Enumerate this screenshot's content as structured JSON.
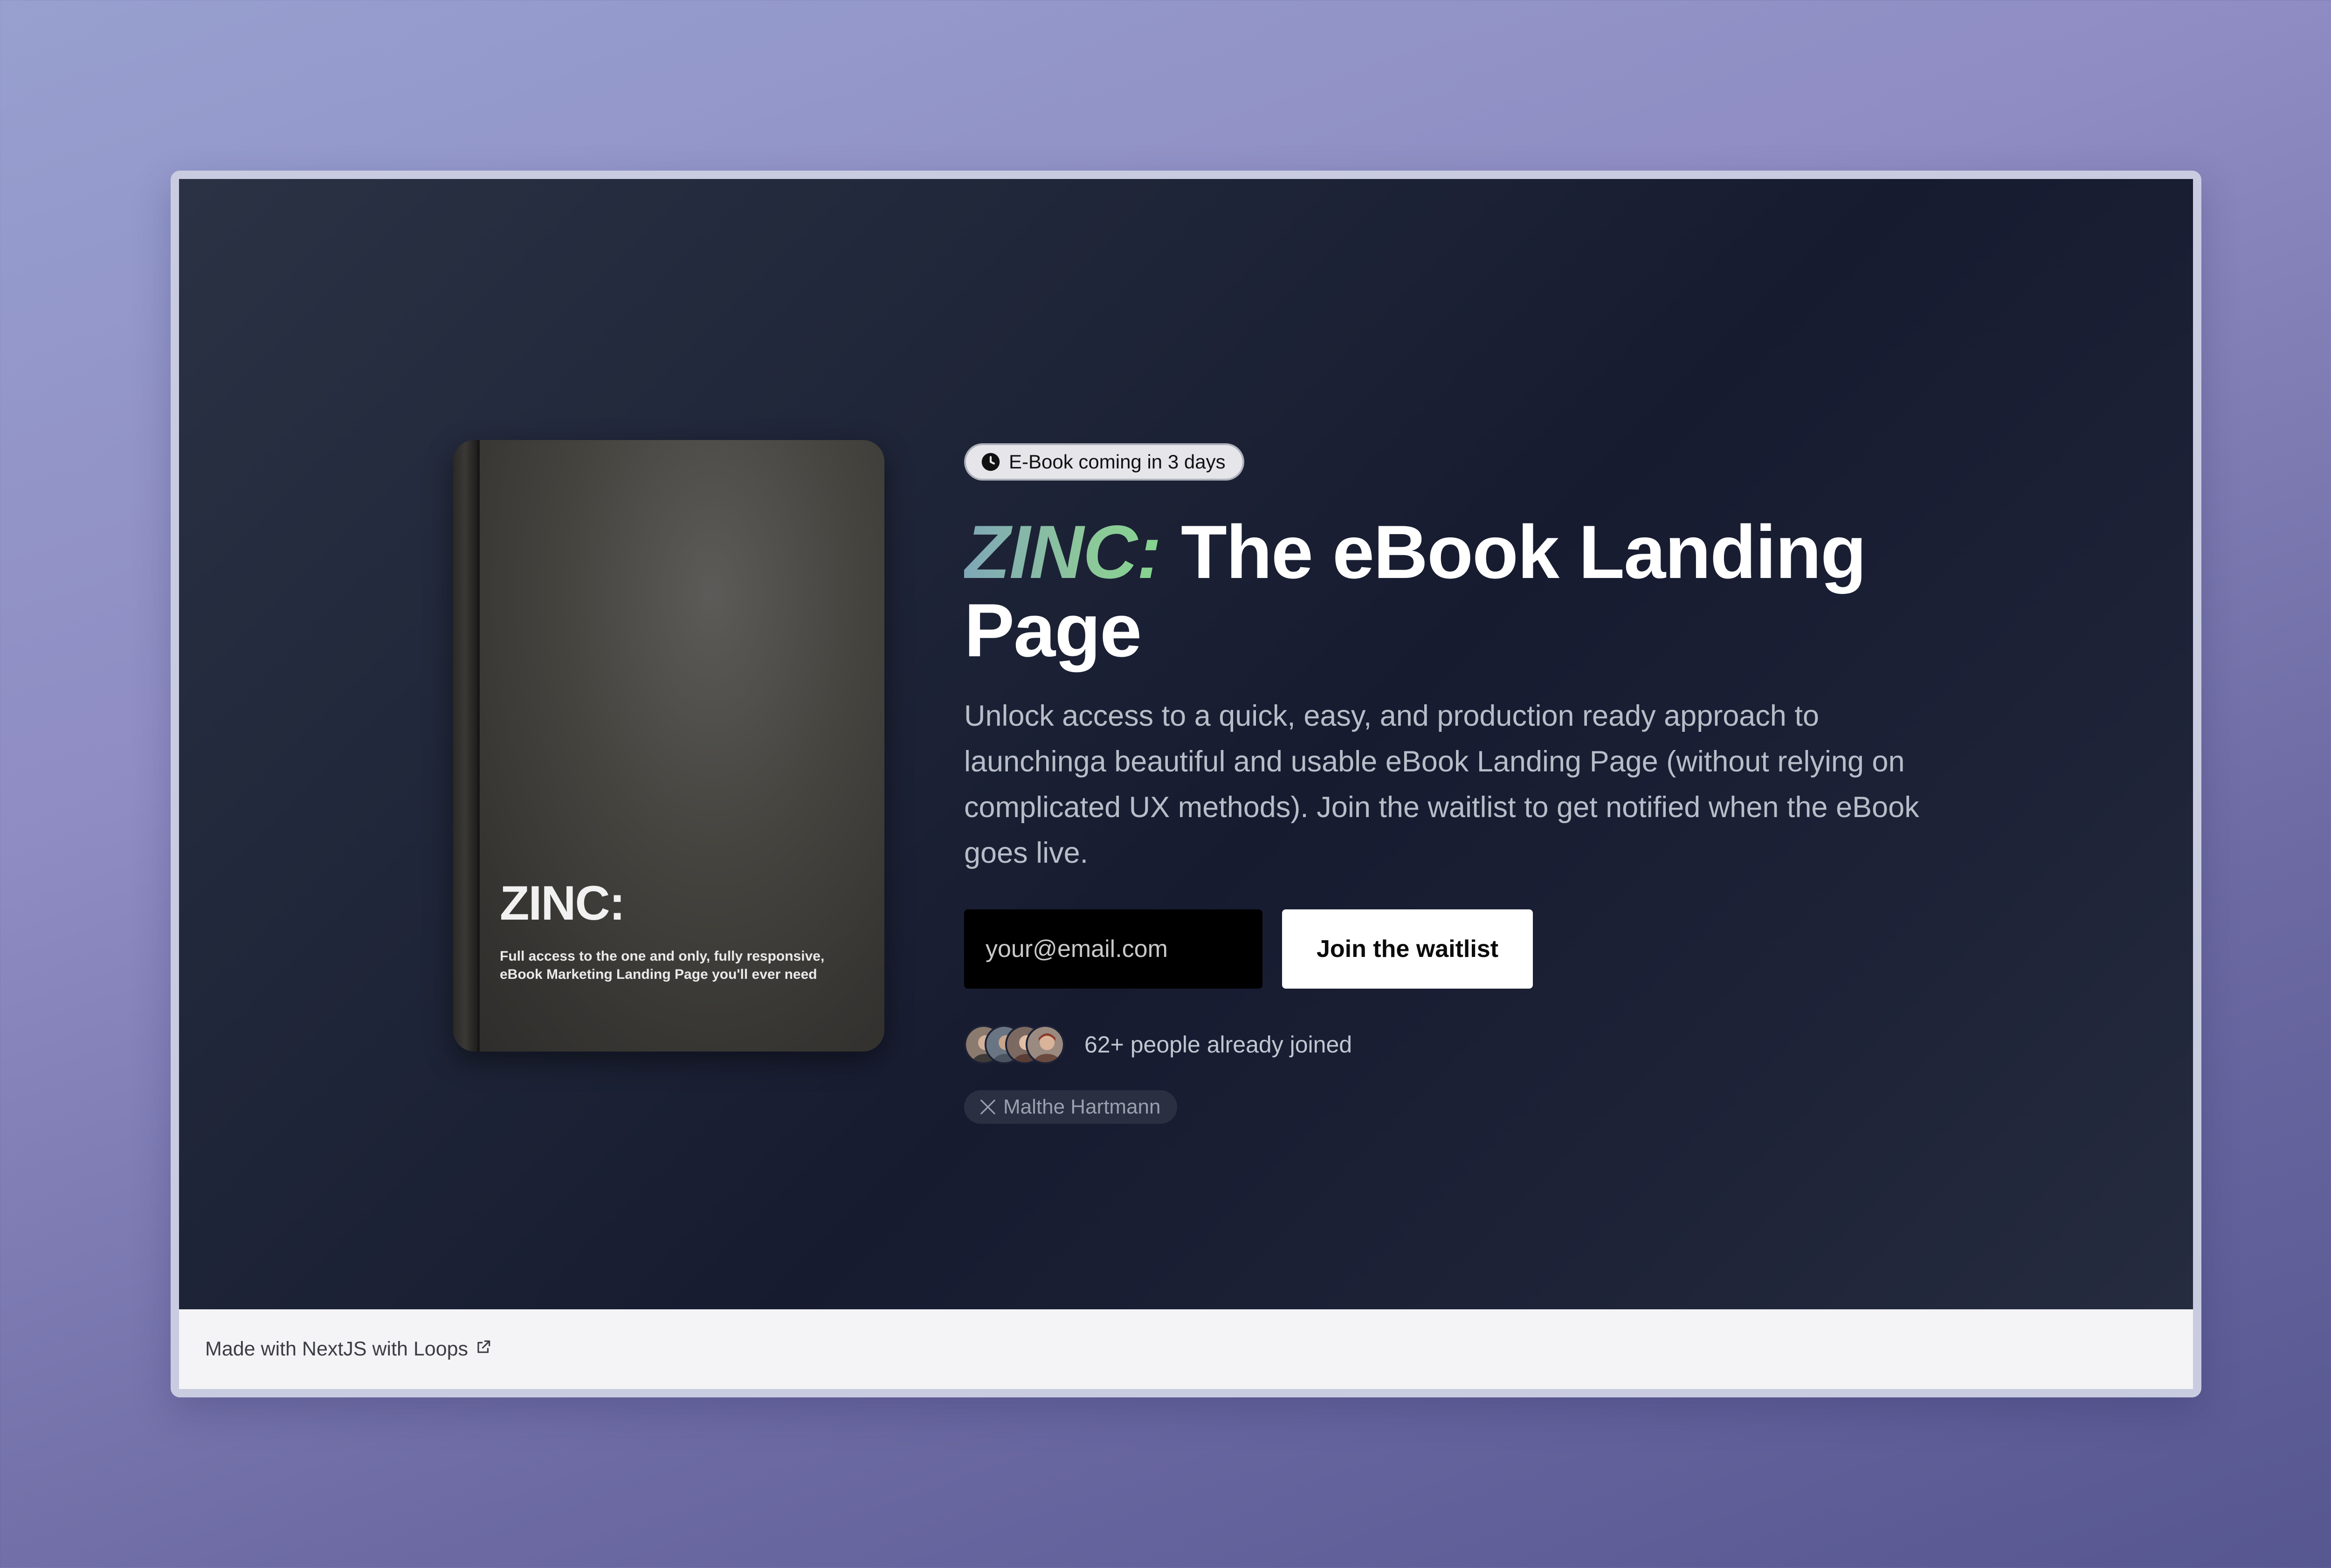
{
  "badge": {
    "text": "E-Book coming in 3 days",
    "icon": "clock-icon"
  },
  "book": {
    "title": "ZINC:",
    "subtitle": "Full access to the one and only, fully responsive, eBook Marketing Landing Page you'll ever need"
  },
  "headline": {
    "brand": "ZINC:",
    "rest": "The eBook Landing Page"
  },
  "description": "Unlock access to a quick, easy, and production ready approach to launchinga beautiful and usable eBook Landing Page (without relying on complicated UX methods). Join the waitlist to get notified when the eBook goes live.",
  "form": {
    "email_placeholder": "your@email.com",
    "email_value": "",
    "submit_label": "Join the waitlist"
  },
  "social_proof": {
    "text": "62+ people already joined",
    "avatar_count": 4
  },
  "author": {
    "icon": "x-logo-icon",
    "name": "Malthe Hartmann"
  },
  "footer": {
    "text": "Made with NextJS with Loops",
    "icon": "external-link-icon"
  },
  "colors": {
    "hero_bg": "#1e2437",
    "brand_gradient_start": "#7fa7b8",
    "brand_gradient_end": "#86d48f",
    "button_bg": "#ffffff",
    "input_bg": "#000000",
    "footer_bg": "#f4f4f7"
  }
}
